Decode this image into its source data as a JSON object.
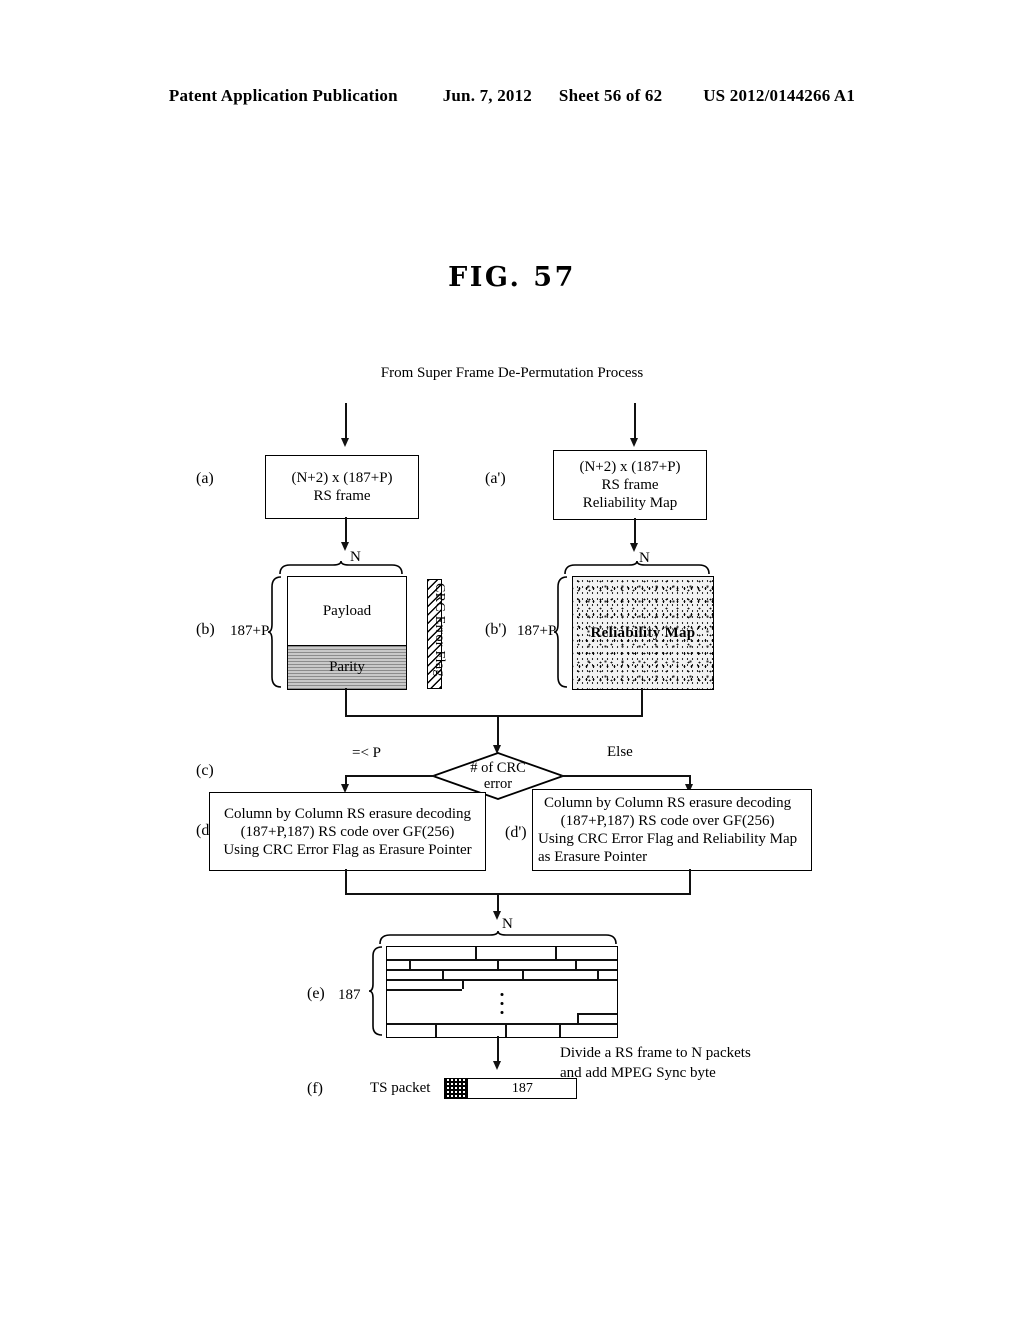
{
  "header": {
    "publication": "Patent Application Publication",
    "date": "Jun. 7, 2012",
    "sheet": "Sheet 56 of 62",
    "patent_number": "US 2012/0144266 A1"
  },
  "figure": {
    "title": "FIG. 57",
    "source_caption": "From Super Frame De-Permutation Process"
  },
  "steps": {
    "a": {
      "id": "(a)",
      "line1": "(N+2) x (187+P)",
      "line2": "RS frame"
    },
    "a_prime": {
      "id": "(a')",
      "line1": "(N+2) x (187+P)",
      "line2": "RS frame",
      "line3": "Reliability Map"
    },
    "b": {
      "id": "(b)",
      "row_label": "187+P",
      "col_label": "N",
      "payload": "Payload",
      "parity": "Parity",
      "crc_flag": "CRC Error Flag"
    },
    "b_prime": {
      "id": "(b')",
      "row_label": "187+P",
      "col_label": "N",
      "map_label": "Reliability Map"
    },
    "c": {
      "id": "(c)",
      "decision_line1": "# of CRC",
      "decision_line2": "error",
      "branch_left": "=< P",
      "branch_right": "Else"
    },
    "d": {
      "id": "(d)",
      "line1": "Column by Column RS erasure decoding",
      "line2": "(187+P,187) RS code over GF(256)",
      "line3": "Using CRC Error Flag as Erasure Pointer"
    },
    "d_prime": {
      "id": "(d')",
      "line1": "Column by Column RS erasure decoding",
      "line2": "(187+P,187) RS code over GF(256)",
      "line3": "Using CRC Error Flag and Reliability Map",
      "line4": "as Erasure Pointer"
    },
    "e": {
      "id": "(e)",
      "row_label": "187",
      "col_label": "N"
    },
    "f": {
      "id": "(f)",
      "packet_label": "TS packet",
      "payload_size": "187",
      "note_line1": "Divide a RS frame to N packets",
      "note_line2": "and add MPEG Sync byte"
    }
  },
  "colors": {
    "ink": "#000000",
    "paper": "#ffffff",
    "parity_fill": "#c9c9c9"
  }
}
